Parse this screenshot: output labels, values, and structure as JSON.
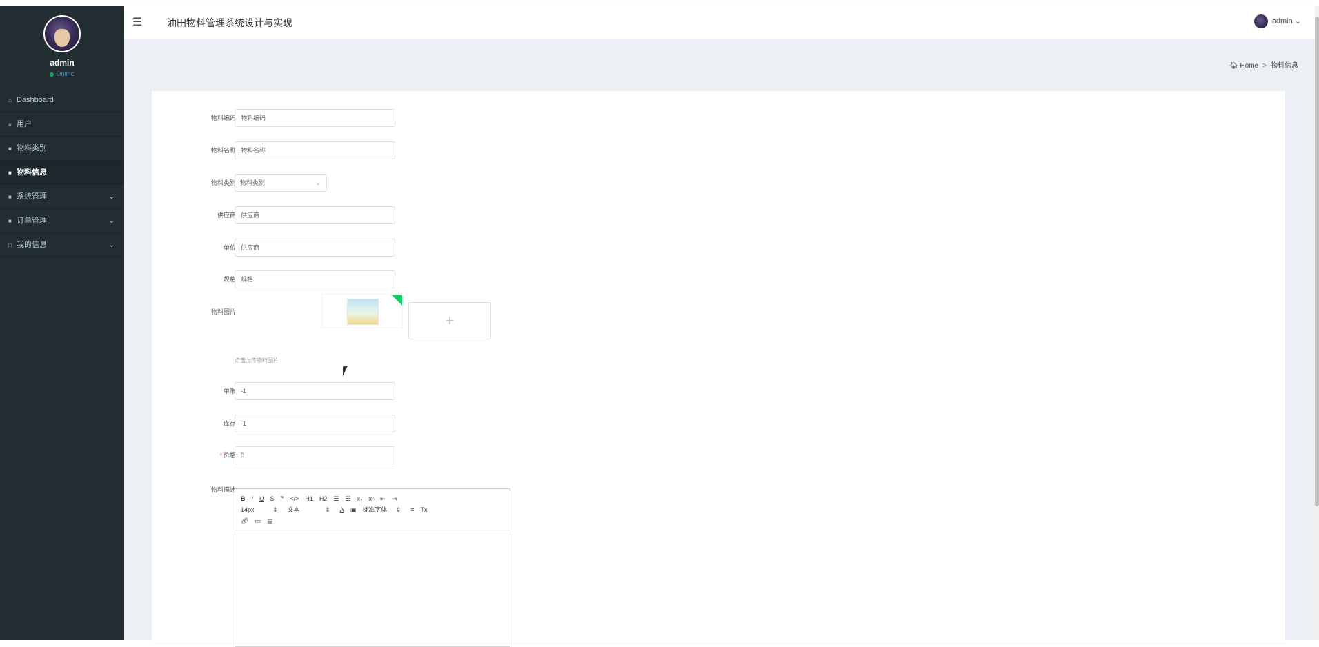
{
  "app": {
    "title": "油田物料管理系统设计与实现",
    "menu_icon": "☰"
  },
  "sidebar": {
    "user": {
      "name": "admin",
      "status": "Online"
    },
    "items": [
      {
        "label": "Dashboard",
        "icon": "⌂"
      },
      {
        "label": "用户",
        "icon": "≡"
      },
      {
        "label": "物料类别",
        "icon": "■"
      },
      {
        "label": "物料信息",
        "icon": "■"
      },
      {
        "label": "系统管理",
        "icon": "■"
      },
      {
        "label": "订单管理",
        "icon": "■"
      },
      {
        "label": "我的信息",
        "icon": "□"
      }
    ],
    "chevron": "⌄"
  },
  "header": {
    "user_label": "admin ⌄"
  },
  "breadcrumb": {
    "home": "🏠︎ Home",
    "sep": ">",
    "current": "物料信息"
  },
  "form": {
    "code": {
      "label": "物料编码",
      "value": "物料编码"
    },
    "name": {
      "label": "物料名称",
      "value": "物料名称"
    },
    "category": {
      "label": "物料类别",
      "value": "物料类别",
      "chevron": "⌄"
    },
    "supplier": {
      "label": "供应商",
      "value": "供应商"
    },
    "unit": {
      "label": "单位",
      "value": "供应商"
    },
    "spec": {
      "label": "规格",
      "value": "规格"
    },
    "image": {
      "label": "物料图片",
      "upload_plus": "+",
      "hint": "点击上传物料图片"
    },
    "limit": {
      "label": "单限",
      "value": "-1"
    },
    "stock": {
      "label": "库存",
      "value": "-1"
    },
    "price": {
      "label": "价格",
      "required_mark": "*",
      "value": "0"
    },
    "description": {
      "label": "物料描述"
    }
  },
  "editor_toolbar": {
    "row1": [
      "B",
      "I",
      "U",
      "S",
      "❞",
      "</>",
      "H1",
      "H2",
      "☰",
      "☷",
      "x₂",
      "x²",
      "⇤",
      "⇥"
    ],
    "row2": [
      "14px",
      "文本",
      "A",
      "▣",
      "标准字体",
      "≡",
      "Tx"
    ],
    "row3": [
      "🔗︎",
      "▭",
      "▤"
    ],
    "select_arrow": "⇕"
  },
  "colors": {
    "sidebar_bg": "#222d32",
    "content_bg": "#ecf0f5",
    "status_online": "#00a65a",
    "required": "#f56c6c",
    "upload_ok": "#13ce66"
  }
}
